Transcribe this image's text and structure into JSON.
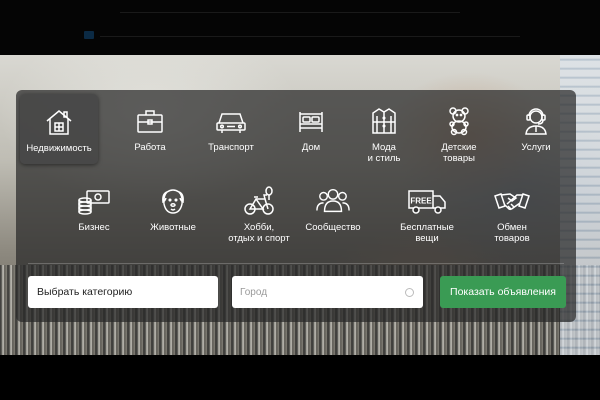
{
  "categories_row1": [
    {
      "label": "Недвижимость",
      "icon": "house-icon"
    },
    {
      "label": "Работа",
      "icon": "briefcase-icon"
    },
    {
      "label": "Транспорт",
      "icon": "car-icon"
    },
    {
      "label": "Дом",
      "icon": "bed-icon"
    },
    {
      "label": "Мода\nи стиль",
      "icon": "jacket-icon"
    },
    {
      "label": "Детские\nтовары",
      "icon": "teddy-bear-icon"
    },
    {
      "label": "Услуги",
      "icon": "support-agent-icon"
    }
  ],
  "categories_row2": [
    {
      "label": "Бизнес",
      "icon": "money-coins-icon"
    },
    {
      "label": "Животные",
      "icon": "dog-icon"
    },
    {
      "label": "Хобби,\nотдых и спорт",
      "icon": "bicycle-icon"
    },
    {
      "label": "Сообщество",
      "icon": "people-icon"
    },
    {
      "label": "Бесплатные\nвещи",
      "icon": "free-truck-icon"
    },
    {
      "label": "Обмен\nтоваров",
      "icon": "handshake-icon"
    }
  ],
  "free_truck_text": "FREE",
  "search": {
    "category_select": "Выбрать категорию",
    "city_placeholder": "Город",
    "submit_label": "Показать объявления"
  },
  "colors": {
    "accent_green": "#3a9b54",
    "panel_overlay": "rgba(40,40,40,0.72)"
  }
}
